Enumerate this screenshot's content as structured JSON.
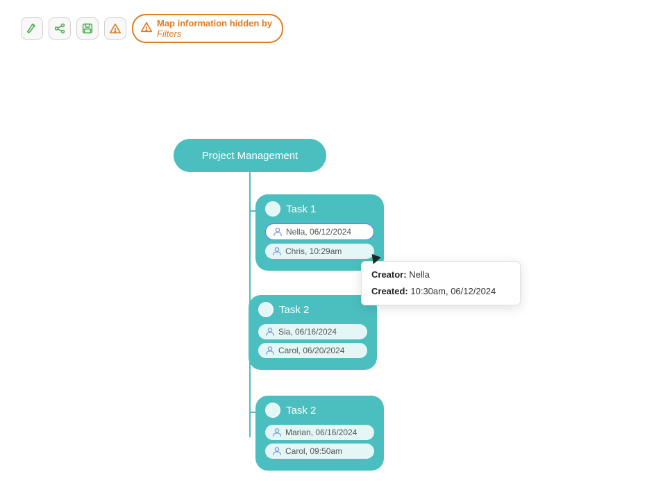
{
  "toolbar": {
    "icons": [
      "edit-icon",
      "share-icon",
      "save-icon",
      "warning-icon"
    ],
    "filter_badge": {
      "line1": "Map information hidden by",
      "line2": "Filters"
    }
  },
  "mindmap": {
    "root": {
      "label": "Project Management"
    },
    "task1": {
      "header": "Task 1",
      "rows": [
        {
          "text": "Nella, 06/12/2024",
          "highlighted": true
        },
        {
          "text": "Chris, 10:29am",
          "highlighted": false
        }
      ]
    },
    "task2a": {
      "header": "Task 2",
      "rows": [
        {
          "text": "Sia, 06/16/2024",
          "highlighted": false
        },
        {
          "text": "Carol, 06/20/2024",
          "highlighted": false
        }
      ]
    },
    "task2b": {
      "header": "Task 2",
      "rows": [
        {
          "text": "Marian, 06/16/2024",
          "highlighted": false
        },
        {
          "text": "Carol, 09:50am",
          "highlighted": false
        }
      ]
    }
  },
  "tooltip": {
    "creator_label": "Creator:",
    "creator_value": "Nella",
    "created_label": "Created:",
    "created_value": "10:30am, 06/12/2024"
  }
}
